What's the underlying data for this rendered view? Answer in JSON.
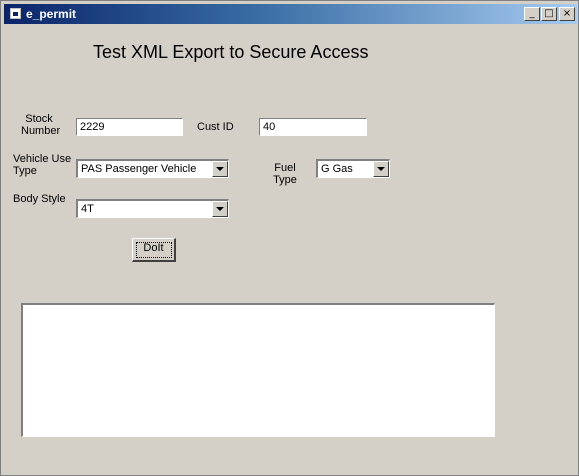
{
  "window": {
    "title": "e_permit",
    "minimize_glyph": "_",
    "maximize_glyph": "□",
    "close_glyph": "×"
  },
  "heading": "Test XML Export to Secure Access",
  "stock": {
    "label": "Stock Number",
    "value": "2229"
  },
  "cust": {
    "label": "Cust ID",
    "value": "40"
  },
  "vehicle_use": {
    "label": "Vehicle Use Type",
    "selected": "PAS  Passenger Vehicle"
  },
  "fuel": {
    "label": "Fuel Type",
    "selected": "G  Gas"
  },
  "body_style": {
    "label": "Body Style",
    "selected": "4T"
  },
  "button": {
    "label": "DoIt"
  },
  "output": {
    "value": ""
  }
}
